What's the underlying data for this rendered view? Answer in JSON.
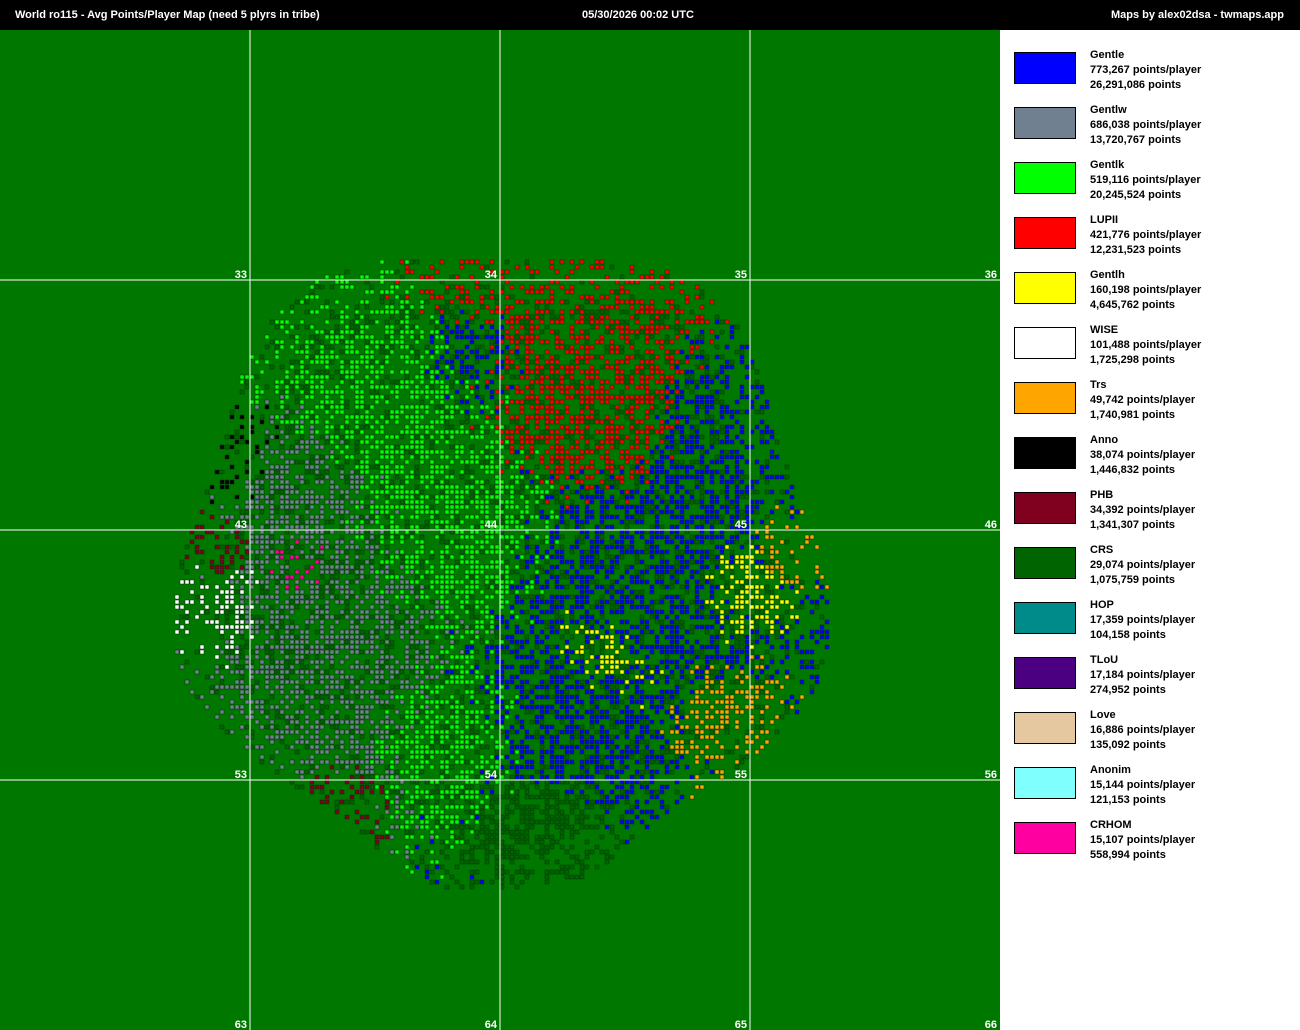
{
  "header": {
    "title": "World ro115  -  Avg Points/Player Map (need 5 plyrs in tribe)",
    "timestamp": "05/30/2026 00:02 UTC",
    "credit": "Maps by alex02dsa - twmaps.app"
  },
  "map": {
    "background_color": "#007800",
    "grid_color": "#ffffff",
    "continent_labels": [
      "33",
      "34",
      "35",
      "36",
      "43",
      "44",
      "45",
      "46",
      "53",
      "54",
      "55",
      "56",
      "63",
      "64",
      "65",
      "66"
    ]
  },
  "legend": [
    {
      "name": "Gentle",
      "avg": "773,267 points/player",
      "total": "26,291,086 points",
      "color": "#0000ff"
    },
    {
      "name": "Gentlw",
      "avg": "686,038 points/player",
      "total": "13,720,767 points",
      "color": "#708090"
    },
    {
      "name": "Gentlk",
      "avg": "519,116 points/player",
      "total": "20,245,524 points",
      "color": "#00ff00"
    },
    {
      "name": "LUPII",
      "avg": "421,776 points/player",
      "total": "12,231,523 points",
      "color": "#ff0000"
    },
    {
      "name": "Gentlh",
      "avg": "160,198 points/player",
      "total": "4,645,762 points",
      "color": "#ffff00"
    },
    {
      "name": "WISE",
      "avg": "101,488 points/player",
      "total": "1,725,298 points",
      "color": "#ffffff"
    },
    {
      "name": "Trs",
      "avg": "49,742 points/player",
      "total": "1,740,981 points",
      "color": "#ffa500"
    },
    {
      "name": "Anno",
      "avg": "38,074 points/player",
      "total": "1,446,832 points",
      "color": "#000000"
    },
    {
      "name": "PHB",
      "avg": "34,392 points/player",
      "total": "1,341,307 points",
      "color": "#800020"
    },
    {
      "name": "CRS",
      "avg": "29,074 points/player",
      "total": "1,075,759 points",
      "color": "#006400"
    },
    {
      "name": "HOP",
      "avg": "17,359 points/player",
      "total": "104,158 points",
      "color": "#008b8b"
    },
    {
      "name": "TLoU",
      "avg": "17,184 points/player",
      "total": "274,952 points",
      "color": "#4b0082"
    },
    {
      "name": "Love",
      "avg": "16,886 points/player",
      "total": "135,092 points",
      "color": "#e6c8a0"
    },
    {
      "name": "Anonim",
      "avg": "15,144 points/player",
      "total": "121,153 points",
      "color": "#80ffff"
    },
    {
      "name": "CRHOM",
      "avg": "15,107 points/player",
      "total": "558,994 points",
      "color": "#ff00a0"
    }
  ]
}
